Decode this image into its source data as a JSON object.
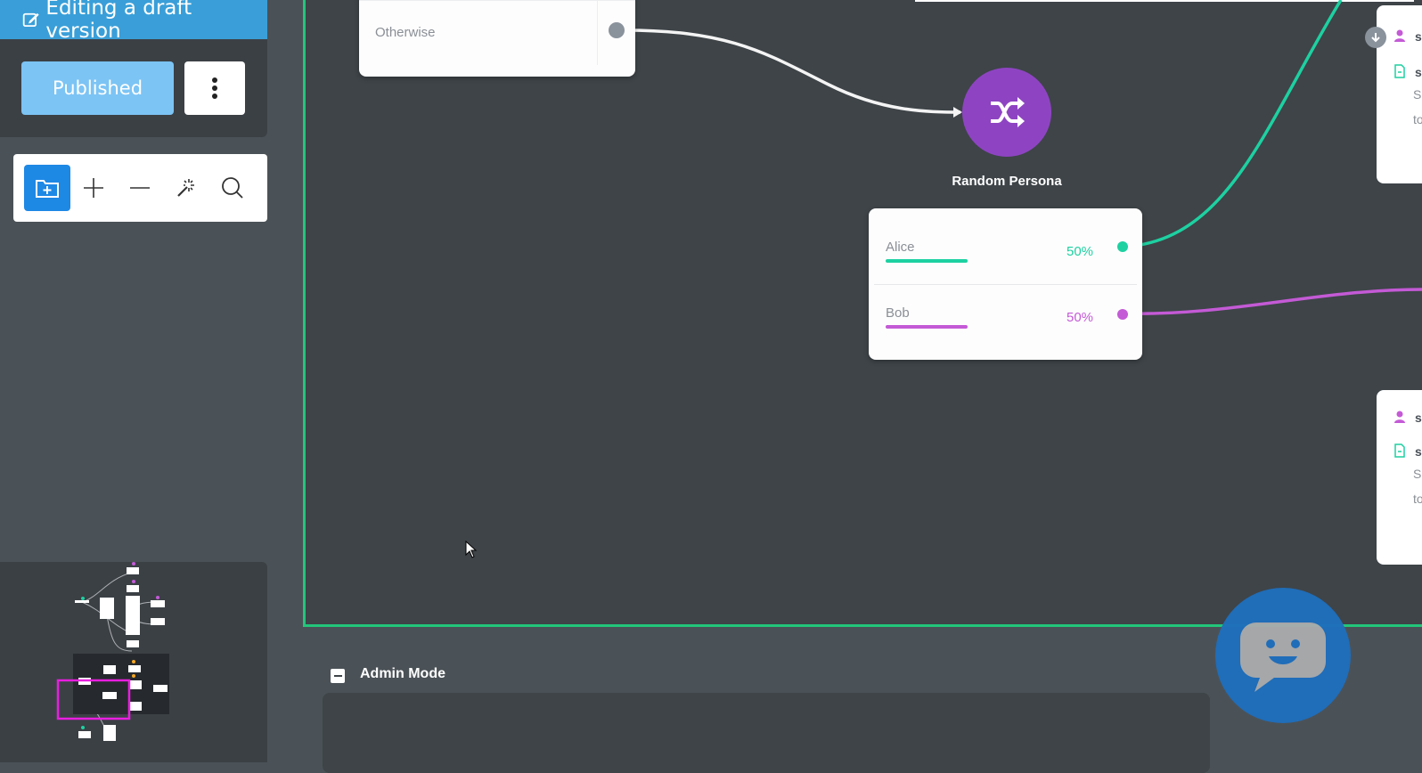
{
  "sidebar": {
    "draft_banner": "Editing a draft version",
    "published_label": "Published",
    "tools": [
      "add-folder",
      "zoom-in",
      "zoom-out",
      "auto-arrange",
      "search"
    ]
  },
  "canvas": {
    "otherwise_label": "Otherwise",
    "random_node_title": "Random Persona",
    "split": [
      {
        "name": "Alice",
        "percent": "50%",
        "color": "#1dd1a1"
      },
      {
        "name": "Bob",
        "percent": "50%",
        "color": "#c45ad6"
      }
    ],
    "right_cards": [
      {
        "letter": "s",
        "line1": "s",
        "line2": "S",
        "line3": "to"
      },
      {
        "letter": "s",
        "line1": "s",
        "line2": "S",
        "line3": "to"
      }
    ]
  },
  "admin": {
    "label": "Admin Mode"
  },
  "colors": {
    "accent_blue": "#3a9fd8",
    "frame_green": "#22c67a",
    "persona_purple": "#8e44c2",
    "chat_blue": "#1f6fbd"
  }
}
